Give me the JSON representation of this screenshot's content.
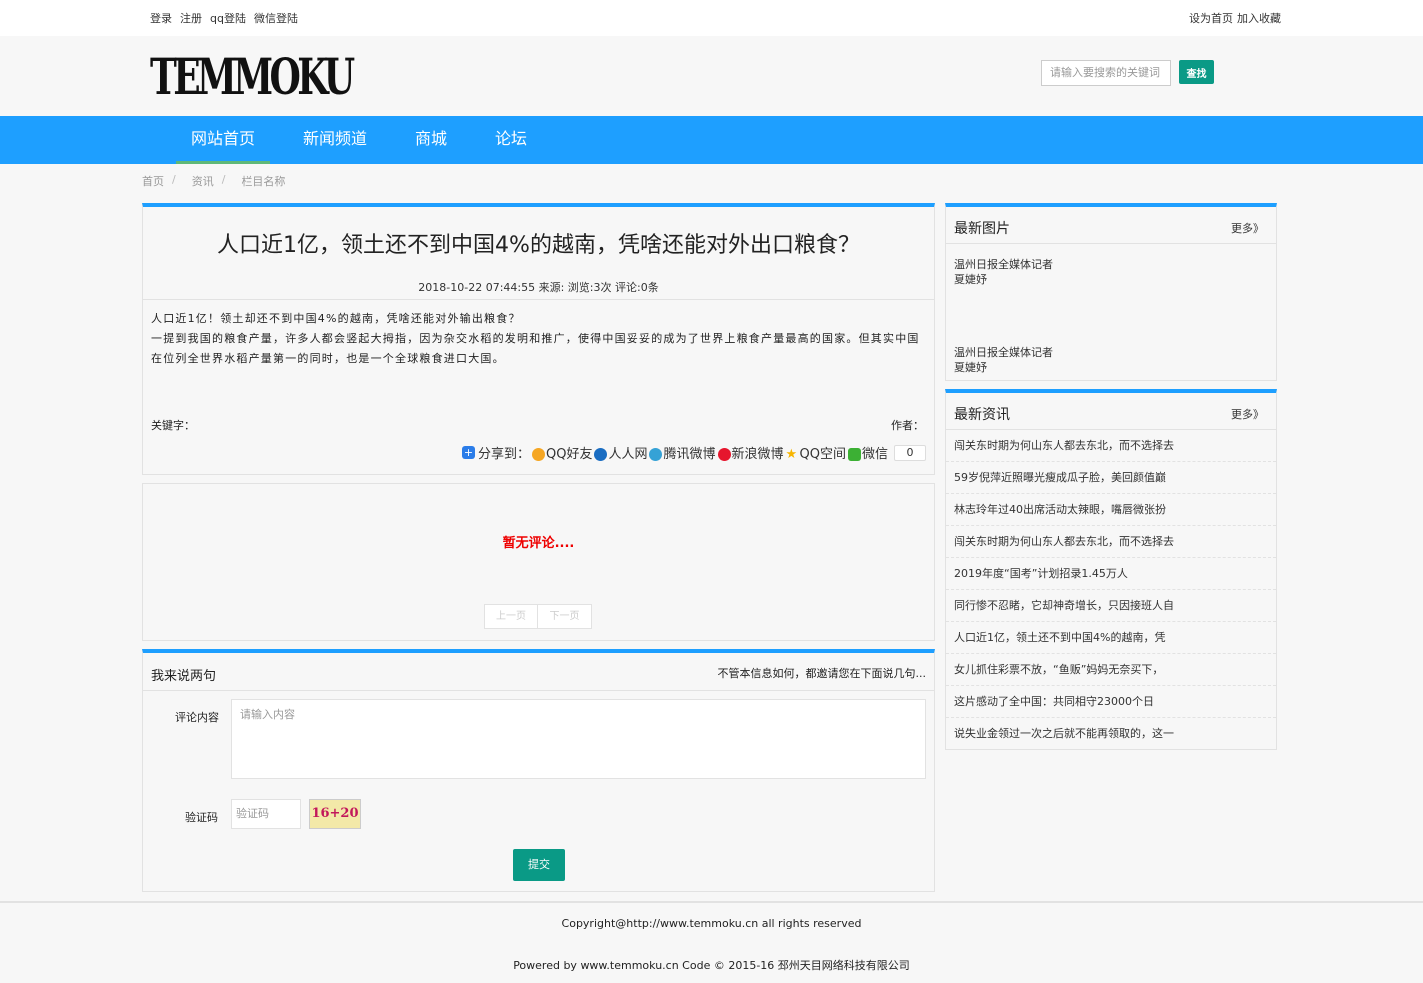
{
  "topbar": {
    "login": "登录",
    "register": "注册",
    "qq_login": "qq登陆",
    "wechat_login": "微信登陆",
    "set_home": "设为首页",
    "add_fav": "加入收藏"
  },
  "header": {
    "logo": "TEMMOKU",
    "search_placeholder": "请输入要搜索的关键词",
    "search_button": "查找"
  },
  "nav": {
    "items": [
      "网站首页",
      "新闻频道",
      "商城",
      "论坛"
    ],
    "active": "网站首页",
    "accent": "#1e9fff"
  },
  "breadcrumb": {
    "items": [
      "首页",
      "资讯",
      "栏目名称"
    ],
    "separator": "/"
  },
  "article": {
    "title": "人口近1亿，领土还不到中国4%的越南，凭啥还能对外出口粮食？",
    "meta": "2018-10-22 07:44:55 来源: 浏览:3次 评论:0条",
    "body_line1": "人口近1亿！领土却还不到中国4%的越南，凭啥还能对外输出粮食？",
    "body_line2": "一提到我国的粮食产量，许多人都会竖起大拇指，因为杂交水稻的发明和推广，使得中国妥妥的成为了世界上粮食产量最高的国家。但其实中国在位列全世界水稻产量第一的同时，也是一个全球粮食进口大国。",
    "keywords_label": "关键字：",
    "author_label": "作者："
  },
  "share": {
    "label": "分享到：",
    "qq": "QQ好友",
    "renren": "人人网",
    "tencent": "腾讯微博",
    "sina": "新浪微博",
    "qzone": "QQ空间",
    "wechat": "微信",
    "count": "0"
  },
  "comments": {
    "empty": "暂无评论....",
    "prev": "上一页",
    "next": "下一页"
  },
  "comment_form": {
    "title": "我来说两句",
    "hint": "不管本信息如何，都邀请您在下面说几句...",
    "content_label": "评论内容",
    "content_placeholder": "请输入内容",
    "captcha_label": "验证码",
    "captcha_placeholder": "验证码",
    "captcha_text": "16+20",
    "submit": "提交"
  },
  "sidebar": {
    "pics": {
      "title": "最新图片",
      "more": "更多》",
      "items": [
        "温州日报全媒体记者 夏婕妤",
        "温州日报全媒体记者 夏婕妤"
      ]
    },
    "news": {
      "title": "最新资讯",
      "more": "更多》",
      "items": [
        "闯关东时期为何山东人都去东北，而不选择去",
        "59岁倪萍近照曝光瘦成瓜子脸，美回颜值巅",
        "林志玲年过40出席活动太辣眼，嘴唇微张扮",
        "闯关东时期为何山东人都去东北，而不选择去",
        "2019年度“国考”计划招录1.45万人",
        "同行惨不忍睹，它却神奇增长，只因接班人自",
        "人口近1亿，领土还不到中国4%的越南，凭",
        "女儿抓住彩票不放，“鱼贩”妈妈无奈买下，",
        "这片感动了全中国：共同相守23000个日",
        "说失业金领过一次之后就不能再领取的，这一"
      ]
    }
  },
  "footer": {
    "copyright": "Copyright@http://www.temmoku.cn all rights reserved",
    "powered": "Powered by www.temmoku.cn Code © 2015-16 邳州天目网络科技有限公司"
  }
}
